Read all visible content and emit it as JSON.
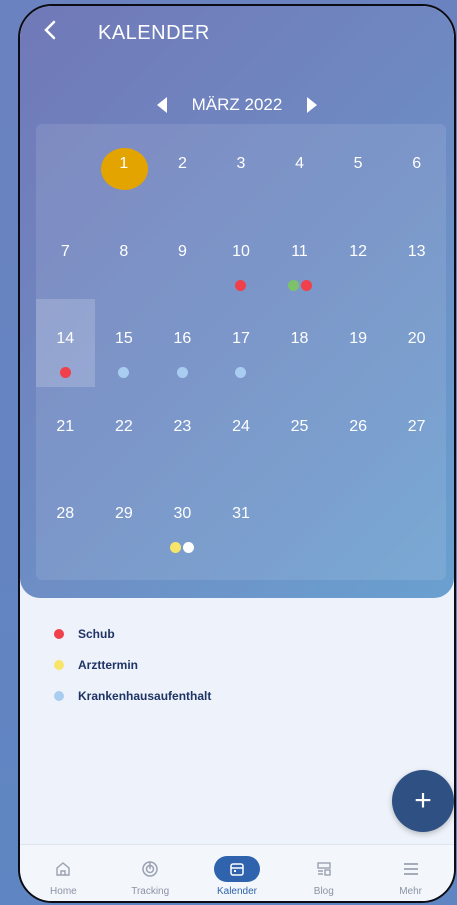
{
  "header": {
    "back_icon": "chevron-left",
    "title": "KALENDER"
  },
  "month": {
    "label": "MÄRZ 2022",
    "prev_icon": "triangle-left",
    "next_icon": "triangle-right"
  },
  "days": [
    {
      "label": "",
      "dots": []
    },
    {
      "label": "1",
      "dots": [],
      "today": true
    },
    {
      "label": "2",
      "dots": []
    },
    {
      "label": "3",
      "dots": []
    },
    {
      "label": "4",
      "dots": []
    },
    {
      "label": "5",
      "dots": []
    },
    {
      "label": "6",
      "dots": []
    },
    {
      "label": "7",
      "dots": []
    },
    {
      "label": "8",
      "dots": []
    },
    {
      "label": "9",
      "dots": []
    },
    {
      "label": "10",
      "dots": [
        "#f0404a"
      ]
    },
    {
      "label": "11",
      "dots": [
        "#7cc26a",
        "#f0404a"
      ]
    },
    {
      "label": "12",
      "dots": []
    },
    {
      "label": "13",
      "dots": []
    },
    {
      "label": "14",
      "dots": [
        "#f0404a"
      ],
      "selected": true
    },
    {
      "label": "15",
      "dots": [
        "#a9cdf0"
      ]
    },
    {
      "label": "16",
      "dots": [
        "#a9cdf0"
      ]
    },
    {
      "label": "17",
      "dots": [
        "#a9cdf0"
      ]
    },
    {
      "label": "18",
      "dots": []
    },
    {
      "label": "19",
      "dots": []
    },
    {
      "label": "20",
      "dots": []
    },
    {
      "label": "21",
      "dots": []
    },
    {
      "label": "22",
      "dots": []
    },
    {
      "label": "23",
      "dots": []
    },
    {
      "label": "24",
      "dots": []
    },
    {
      "label": "25",
      "dots": []
    },
    {
      "label": "26",
      "dots": []
    },
    {
      "label": "27",
      "dots": []
    },
    {
      "label": "28",
      "dots": []
    },
    {
      "label": "29",
      "dots": []
    },
    {
      "label": "30",
      "dots": [
        "#f7e56a",
        "#ffffff"
      ]
    },
    {
      "label": "31",
      "dots": []
    }
  ],
  "legend": [
    {
      "label": "Schub",
      "color": "#f0404a"
    },
    {
      "label": "Arzttermin",
      "color": "#f7e56a"
    },
    {
      "label": "Krankenhausaufenthalt",
      "color": "#a9cdf0"
    }
  ],
  "fab": {
    "label": "+",
    "icon": "plus-icon"
  },
  "tabs": [
    {
      "label": "Home",
      "icon": "home-icon",
      "active": false
    },
    {
      "label": "Tracking",
      "icon": "tracking-icon",
      "active": false
    },
    {
      "label": "Kalender",
      "icon": "calendar-icon",
      "active": true
    },
    {
      "label": "Blog",
      "icon": "blog-icon",
      "active": false
    },
    {
      "label": "Mehr",
      "icon": "menu-icon",
      "active": false
    }
  ],
  "colors": {
    "today": "#e3a400",
    "accent": "#2f63ad",
    "fab": "#2f5083"
  }
}
